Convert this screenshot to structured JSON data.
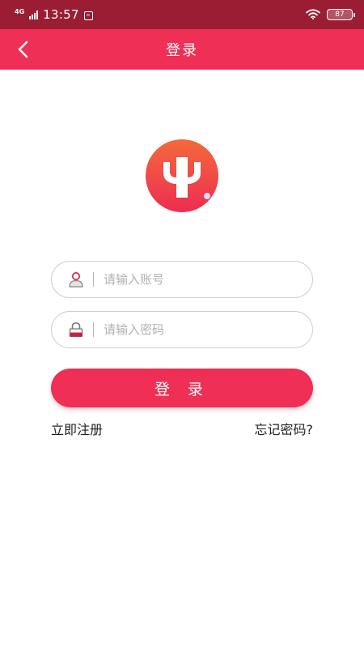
{
  "status_bar": {
    "network": "4G",
    "time": "13:57",
    "battery": "87"
  },
  "header": {
    "title": "登录",
    "back_icon": "chevron-left-icon"
  },
  "logo": {
    "letter": "Y"
  },
  "form": {
    "account": {
      "placeholder": "请输入账号",
      "value": "",
      "icon": "user-icon"
    },
    "password": {
      "placeholder": "请输入密码",
      "value": "",
      "icon": "lock-icon"
    },
    "login_label": "登 录"
  },
  "links": {
    "register": "立即注册",
    "forgot": "忘记密码?"
  },
  "colors": {
    "status_bar": "#9b1d33",
    "brand": "#ef2f55",
    "logo_gradient_top": "#f36a3b",
    "logo_gradient_bottom": "#ee2c52"
  }
}
